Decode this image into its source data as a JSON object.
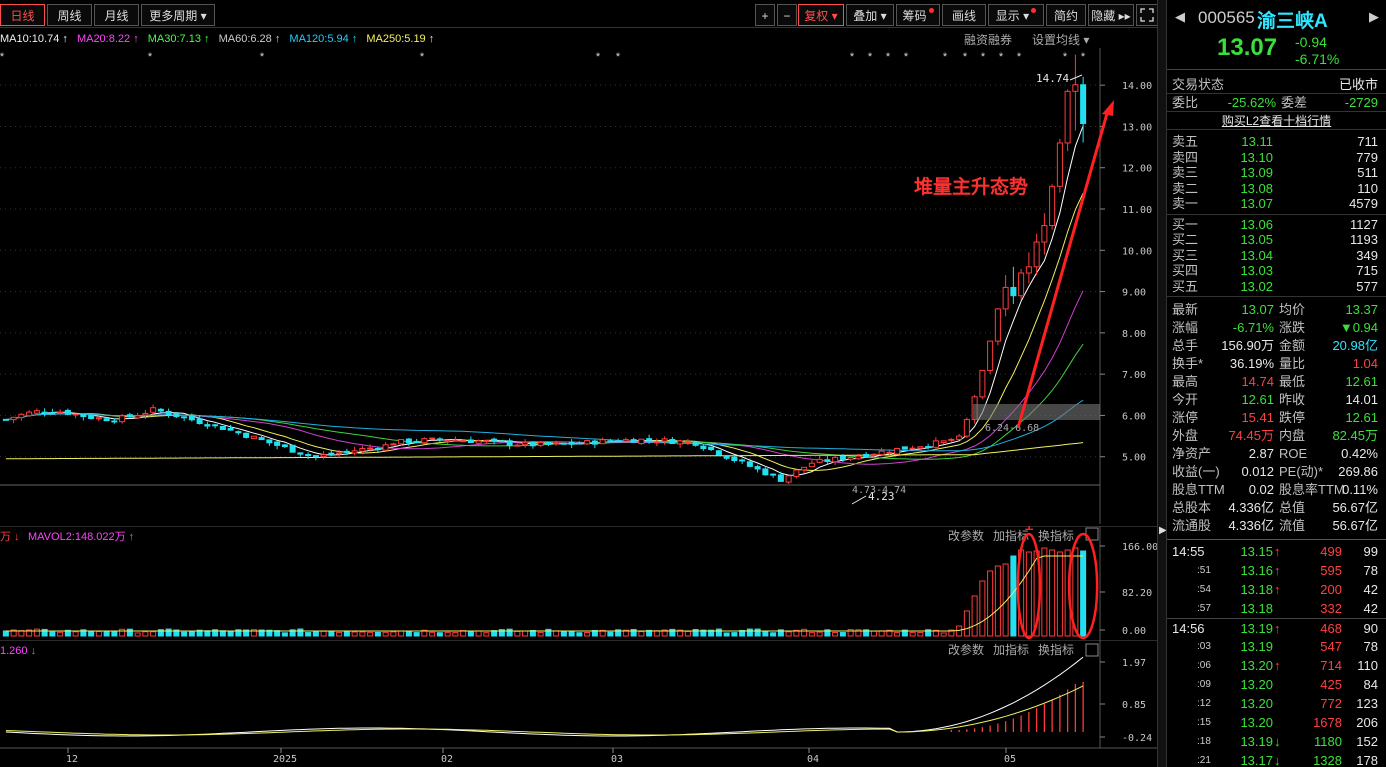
{
  "toolbar": {
    "periods": [
      "日线",
      "周线",
      "月线",
      "更多周期"
    ],
    "tools": [
      "+",
      "−",
      "复权",
      "叠加",
      "筹码",
      "画线",
      "显示",
      "简约",
      "隐藏"
    ]
  },
  "ma_legend": [
    {
      "text": "MA10:10.74",
      "color": "#f0f0f0"
    },
    {
      "text": "MA20:8.22",
      "color": "#ff44ff"
    },
    {
      "text": "MA30:7.13",
      "color": "#44ff44"
    },
    {
      "text": "MA60:6.28",
      "color": "#cccccc"
    },
    {
      "text": "MA120:5.94",
      "color": "#22ccff"
    },
    {
      "text": "MA250:5.19",
      "color": "#f0f060"
    }
  ],
  "chart_links": {
    "margin": "融资融券",
    "ma_setting": "设置均线"
  },
  "chart_data": [
    {
      "type": "candlestick",
      "title": "000565 渝三峡A 日线",
      "y_ticks": [
        "14.00",
        "13.00",
        "12.00",
        "11.00",
        "10.00",
        "9.00",
        "8.00",
        "7.00",
        "6.00",
        "5.00"
      ],
      "ylim": [
        4.0,
        14.9
      ],
      "x_ticks": [
        "12",
        "2025",
        "02",
        "03",
        "04",
        "05"
      ],
      "annotations": {
        "high_label": "14.74",
        "low_label": "4.23",
        "range_label": "4.73-4.74",
        "box_label": "6.24-6.68",
        "trend_text": "堆量主升态势"
      },
      "ohlc_late": [
        [
          5.4,
          5.45,
          5.36,
          5.42
        ],
        [
          5.42,
          5.55,
          5.4,
          5.5
        ],
        [
          5.5,
          5.95,
          5.45,
          5.9
        ],
        [
          5.9,
          6.5,
          5.8,
          6.45
        ],
        [
          6.45,
          7.1,
          6.4,
          7.09
        ],
        [
          7.09,
          7.8,
          7.0,
          7.8
        ],
        [
          7.8,
          8.6,
          7.7,
          8.58
        ],
        [
          8.58,
          9.4,
          8.4,
          9.1
        ],
        [
          9.1,
          9.6,
          8.7,
          8.9
        ],
        [
          8.9,
          9.55,
          8.8,
          9.45
        ],
        [
          9.45,
          9.95,
          9.2,
          9.6
        ],
        [
          9.6,
          10.4,
          9.4,
          10.2
        ],
        [
          10.2,
          10.9,
          9.9,
          10.6
        ],
        [
          10.6,
          11.6,
          10.5,
          11.55
        ],
        [
          11.55,
          12.7,
          11.4,
          12.6
        ],
        [
          12.6,
          13.9,
          12.4,
          13.85
        ],
        [
          13.85,
          14.74,
          12.9,
          14.01
        ],
        [
          14.01,
          14.2,
          12.61,
          13.07
        ]
      ]
    },
    {
      "type": "bar",
      "title": "VOL",
      "legend": [
        "万",
        "MAVOL2:148.022万"
      ],
      "y_ticks": [
        "166.00",
        "82.20",
        "0.00"
      ],
      "buttons": [
        "改参数",
        "加指标",
        "换指标"
      ],
      "markers": [
        "1",
        "2"
      ]
    },
    {
      "type": "line",
      "title": "MACD",
      "legend": [
        "1.260"
      ],
      "y_ticks": [
        "1.97",
        "0.85",
        "-0.24"
      ],
      "buttons": [
        "改参数",
        "加指标",
        "换指标"
      ]
    }
  ],
  "stock": {
    "code": "000565",
    "name": "渝三峡A",
    "price": "13.07",
    "change": "-0.94",
    "change_pct": "-6.71%",
    "status_label": "交易状态",
    "status": "已收市",
    "weibi_label": "委比",
    "weibi": "-25.62%",
    "weicha_label": "委差",
    "weicha": "-2729",
    "l2_link": "购买L2查看十档行情"
  },
  "order_book": {
    "asks": [
      {
        "label": "卖五",
        "price": "13.11",
        "vol": "711"
      },
      {
        "label": "卖四",
        "price": "13.10",
        "vol": "779"
      },
      {
        "label": "卖三",
        "price": "13.09",
        "vol": "511"
      },
      {
        "label": "卖二",
        "price": "13.08",
        "vol": "110"
      },
      {
        "label": "卖一",
        "price": "13.07",
        "vol": "4579"
      }
    ],
    "bids": [
      {
        "label": "买一",
        "price": "13.06",
        "vol": "1127"
      },
      {
        "label": "买二",
        "price": "13.05",
        "vol": "1193"
      },
      {
        "label": "买三",
        "price": "13.04",
        "vol": "349"
      },
      {
        "label": "买四",
        "price": "13.03",
        "vol": "715"
      },
      {
        "label": "买五",
        "price": "13.02",
        "vol": "577"
      }
    ]
  },
  "stats": [
    {
      "l1": "最新",
      "v1": "13.07",
      "c1": "green",
      "l2": "均价",
      "v2": "13.37",
      "c2": "green"
    },
    {
      "l1": "涨幅",
      "v1": "-6.71%",
      "c1": "green",
      "l2": "涨跌",
      "v2": "▼0.94",
      "c2": "green"
    },
    {
      "l1": "总手",
      "v1": "156.90万",
      "c1": "white",
      "l2": "金额",
      "v2": "20.98亿",
      "c2": "cyan"
    },
    {
      "l1": "换手*",
      "v1": "36.19%",
      "c1": "white",
      "l2": "量比",
      "v2": "1.04",
      "c2": "red"
    },
    {
      "l1": "最高",
      "v1": "14.74",
      "c1": "red",
      "l2": "最低",
      "v2": "12.61",
      "c2": "green"
    },
    {
      "l1": "今开",
      "v1": "12.61",
      "c1": "green",
      "l2": "昨收",
      "v2": "14.01",
      "c2": "white"
    },
    {
      "l1": "涨停",
      "v1": "15.41",
      "c1": "red",
      "l2": "跌停",
      "v2": "12.61",
      "c2": "green"
    },
    {
      "l1": "外盘",
      "v1": "74.45万",
      "c1": "red",
      "l2": "内盘",
      "v2": "82.45万",
      "c2": "green"
    },
    {
      "l1": "净资产",
      "v1": "2.87",
      "c1": "white",
      "l2": "ROE",
      "v2": "0.42%",
      "c2": "white"
    },
    {
      "l1": "收益(一)",
      "v1": "0.012",
      "c1": "white",
      "l2": "PE(动)*",
      "v2": "269.86",
      "c2": "white"
    },
    {
      "l1": "股息TTM",
      "v1": "0.02",
      "c1": "white",
      "l2": "股息率TTM",
      "v2": "0.11%",
      "c2": "white"
    },
    {
      "l1": "总股本",
      "v1": "4.336亿",
      "c1": "white",
      "l2": "总值",
      "v2": "56.67亿",
      "c2": "white"
    },
    {
      "l1": "流通股",
      "v1": "4.336亿",
      "c1": "white",
      "l2": "流值",
      "v2": "56.67亿",
      "c2": "white"
    }
  ],
  "ticks": [
    {
      "time": "14:55",
      "price": "13.15",
      "arrow": "up",
      "vol": "499",
      "n": "99"
    },
    {
      "time": ":51",
      "price": "13.16",
      "arrow": "up",
      "vol": "595",
      "n": "78"
    },
    {
      "time": ":54",
      "price": "13.18",
      "arrow": "up",
      "vol": "200",
      "n": "42"
    },
    {
      "time": ":57",
      "price": "13.18",
      "arrow": "",
      "vol": "332",
      "n": "42"
    },
    {
      "time": "14:56",
      "price": "13.19",
      "arrow": "up",
      "vol": "468",
      "n": "90"
    },
    {
      "time": ":03",
      "price": "13.19",
      "arrow": "",
      "vol": "547",
      "n": "78"
    },
    {
      "time": ":06",
      "price": "13.20",
      "arrow": "up",
      "vol": "714",
      "n": "110"
    },
    {
      "time": ":09",
      "price": "13.20",
      "arrow": "",
      "vol": "425",
      "n": "84"
    },
    {
      "time": ":12",
      "price": "13.20",
      "arrow": "",
      "vol": "772",
      "n": "123"
    },
    {
      "time": ":15",
      "price": "13.20",
      "arrow": "",
      "vol": "1678",
      "n": "206"
    },
    {
      "time": ":18",
      "price": "13.19",
      "arrow": "down",
      "vol": "1180",
      "n": "152"
    },
    {
      "time": ":21",
      "price": "13.17",
      "arrow": "down",
      "vol": "1328",
      "n": "178"
    }
  ]
}
